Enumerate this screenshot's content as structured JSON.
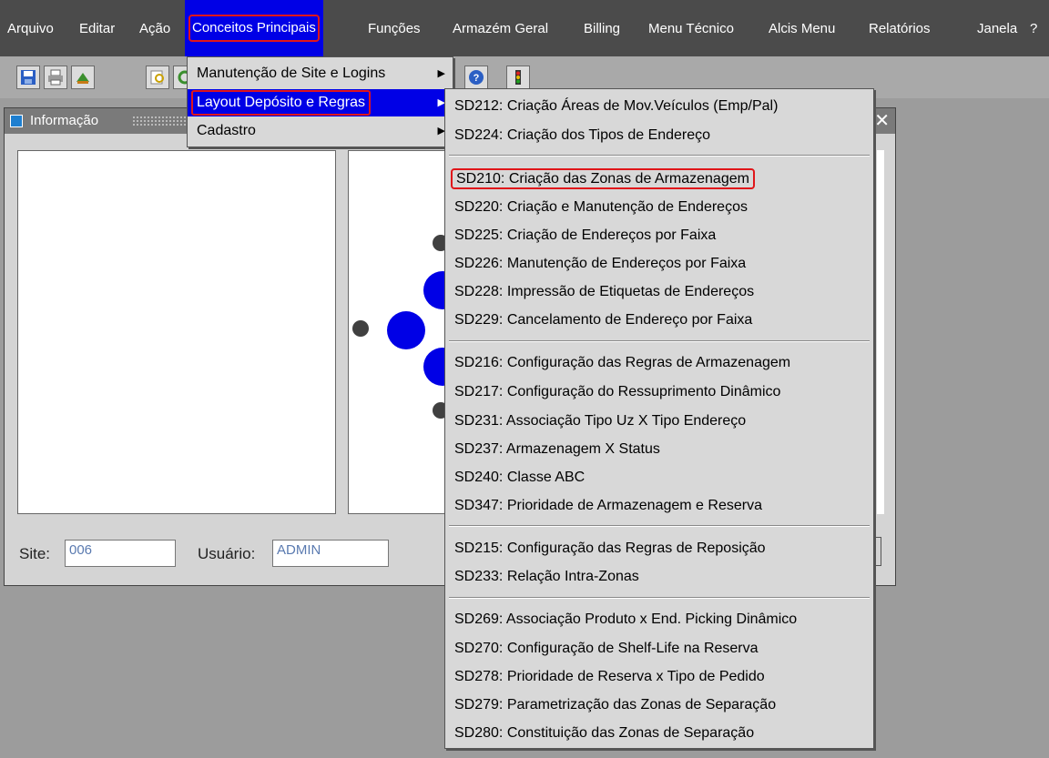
{
  "menubar": {
    "items": [
      "Arquivo",
      "Editar",
      "Ação",
      "Conceitos Principais",
      "Funções",
      "Armazém Geral",
      "Billing",
      "Menu Técnico",
      "Alcis Menu",
      "Relatórios",
      "Janela",
      "?"
    ]
  },
  "window": {
    "title": "Informação",
    "site_label": "Site:",
    "site_value": "006",
    "user_label": "Usuário:",
    "user_value": "ADMIN"
  },
  "menu_conceitos": {
    "items": [
      "Manutenção de Site e Logins",
      "Layout Depósito e Regras",
      "Cadastro"
    ]
  },
  "submenu_layout": {
    "items": [
      "SD212: Criação Áreas de Mov.Veículos (Emp/Pal)",
      "SD224: Criação dos Tipos de Endereço",
      "SD210: Criação das Zonas de Armazenagem",
      "SD220: Criação e Manutenção de Endereços",
      "SD225: Criação de Endereços por Faixa",
      "SD226: Manutenção de Endereços por Faixa",
      "SD228: Impressão de Etiquetas de Endereços",
      "SD229: Cancelamento de Endereço por Faixa",
      "SD216: Configuração das Regras de Armazenagem",
      "SD217: Configuração do Ressuprimento Dinâmico",
      "SD231: Associação Tipo Uz X Tipo Endereço",
      "SD237: Armazenagem X Status",
      "SD240: Classe ABC",
      "SD347: Prioridade de Armazenagem e Reserva",
      "SD215: Configuração das Regras de Reposição",
      "SD233: Relação Intra-Zonas",
      "SD269: Associação Produto x End. Picking Dinâmico",
      "SD270: Configuração de Shelf-Life na Reserva",
      "SD278: Prioridade de Reserva x Tipo de Pedido",
      "SD279: Parametrização das Zonas de Separação",
      "SD280: Constituição das Zonas de Separação"
    ]
  },
  "colors": {
    "menubar_bg": "#4b4b4b",
    "highlight": "#0000e6",
    "annotation_red": "#e0161a"
  }
}
